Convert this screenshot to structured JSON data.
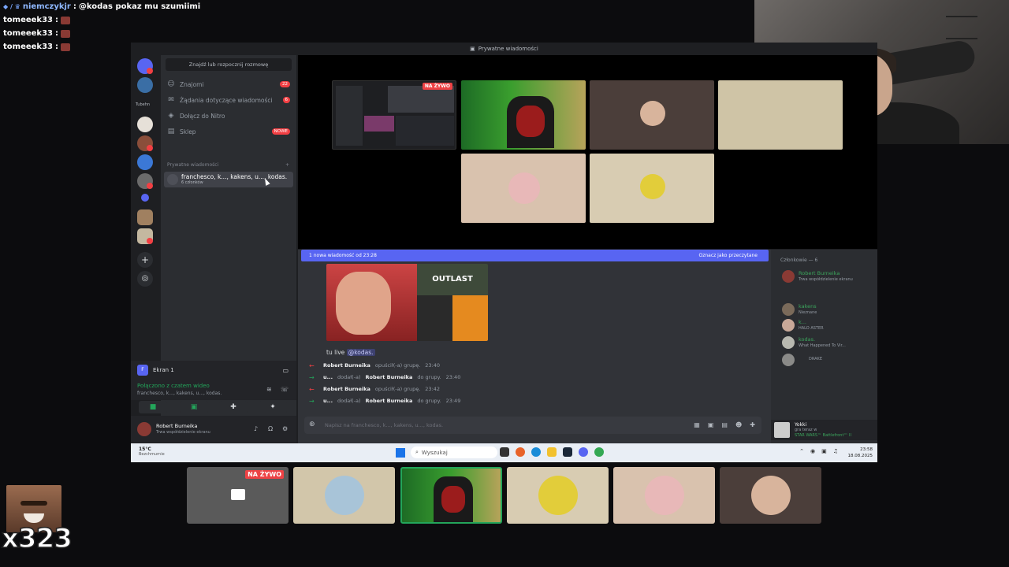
{
  "stream_chat": {
    "lines": [
      {
        "user": "niemczykjr",
        "separator": ":",
        "message": "@kodas pokaz mu szumiimi"
      },
      {
        "user": "tomeeek33",
        "separator": ":",
        "message": ""
      },
      {
        "user": "tomeeek33",
        "separator": ":",
        "message": ""
      },
      {
        "user": "tomeeek33",
        "separator": ":",
        "message": ""
      }
    ]
  },
  "window": {
    "title": "Prywatne wiadomości"
  },
  "servers": {
    "folder_label": "Tubehn"
  },
  "dm_panel": {
    "search_placeholder": "Znajdź lub rozpocznij rozmowę",
    "nav": [
      {
        "label": "Znajomi",
        "count": "22",
        "icon": "friends-icon"
      },
      {
        "label": "Żądania dotyczące wiadomości",
        "count": "6",
        "icon": "inbox-icon"
      },
      {
        "label": "Dołącz do Nitro",
        "count": "",
        "icon": "nitro-icon"
      },
      {
        "label": "Sklep",
        "count": "NOWE",
        "icon": "shop-icon"
      }
    ],
    "section_header": "Prywatne wiadomości",
    "section_add": "+",
    "active_dm": {
      "name": "franchesco, k..., kakens, u..., kodas.",
      "sub": "6 członków"
    }
  },
  "voice": {
    "screen_label": "Ekran 1",
    "status": "Połączono z czatem wideo",
    "channel": "franchesco, k..., kakens, u..., kodas."
  },
  "user_panel": {
    "name": "Robert Burneika",
    "status": "Trwa współdzielenie ekranu"
  },
  "live_badge": "NA ŻYWO",
  "thumb_caption": "OUTLAST",
  "new_messages": {
    "left": "1 nowa wiadomość od 23:28",
    "right": "Oznacz jako przeczytane"
  },
  "message": {
    "text": "tu live",
    "mention": "@kodas."
  },
  "system_rows": [
    {
      "arrow": "←",
      "actor": "Robert Burneika",
      "action": "opuścił(-a) grupę.",
      "target": "",
      "tail": "",
      "time": "23:40",
      "color": "#f23f43"
    },
    {
      "arrow": "→",
      "actor": "u...",
      "action": "dodał(-a)",
      "target": "Robert Burneika",
      "tail": "do grupy.",
      "time": "23:40",
      "color": "#23a55a"
    },
    {
      "arrow": "←",
      "actor": "Robert Burneika",
      "action": "opuścił(-a) grupę.",
      "target": "",
      "tail": "",
      "time": "23:42",
      "color": "#f23f43"
    },
    {
      "arrow": "→",
      "actor": "u...",
      "action": "dodał(-a)",
      "target": "Robert Burneika",
      "tail": "do grupy.",
      "time": "23:49",
      "color": "#23a55a"
    }
  ],
  "composer": {
    "placeholder": "Napisz na franchesco, k..., kakens, u..., kodas."
  },
  "members": {
    "header": "Członkowie — 6",
    "list": [
      {
        "name": "Robert Burneika",
        "status": "Trwa współdzielenie ekranu"
      },
      {
        "name": "kakens",
        "status": "Nieznane"
      },
      {
        "name": "k...",
        "status": "HALO ASTER"
      },
      {
        "name": "kodas.",
        "status": "What Happened To Vir..."
      },
      {
        "name": "",
        "status": "DRAKE"
      }
    ],
    "activity": {
      "name": "Yokki",
      "line1": "gra teraz w",
      "line2": "STAR WARS™ Battlefront™ II"
    }
  },
  "taskbar": {
    "temp": "15°C",
    "weather": "Bezchmurnie",
    "search": "Wyszukaj",
    "time": "23:58",
    "date": "18.08.2025"
  },
  "combo_counter": "x323"
}
